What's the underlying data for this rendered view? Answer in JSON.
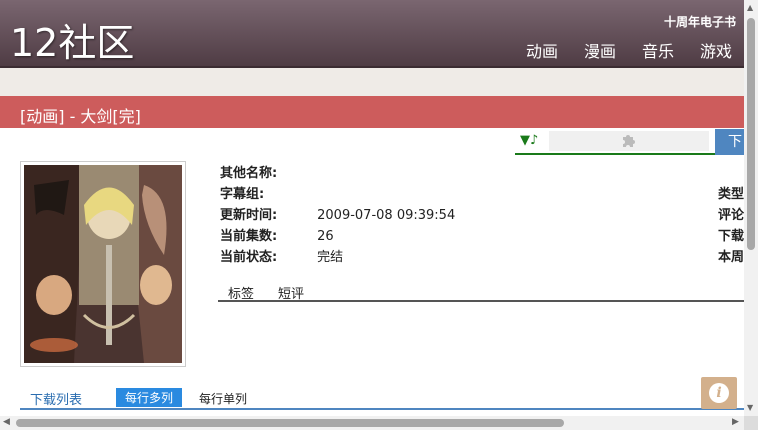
{
  "header": {
    "logo": "12社区",
    "top_link": "十周年电子书",
    "nav": [
      "动画",
      "漫画",
      "音乐",
      "游戏"
    ]
  },
  "title": "[动画] - 大剑[完]",
  "player": {
    "play_icon": "▼♪",
    "download_label": "下"
  },
  "details": {
    "rows": [
      {
        "label": "其他名称:",
        "value": ""
      },
      {
        "label": "字幕组:",
        "value": ""
      },
      {
        "label": "更新时间:",
        "value": "2009-07-08 09:39:54"
      },
      {
        "label": "当前集数:",
        "value": "26"
      },
      {
        "label": "当前状态:",
        "value": "完结"
      }
    ],
    "right_labels": [
      "类型",
      "评论",
      "下载",
      "本周"
    ]
  },
  "tabs": [
    "标签",
    "短评"
  ],
  "download_list": {
    "title": "下载列表",
    "multi": "每行多列",
    "single": "每行单列"
  },
  "colors": {
    "header": "#5f4b53",
    "titlebar": "#cd5c5c",
    "accent": "#2a8ae0",
    "info_button": "#d3b08c"
  }
}
